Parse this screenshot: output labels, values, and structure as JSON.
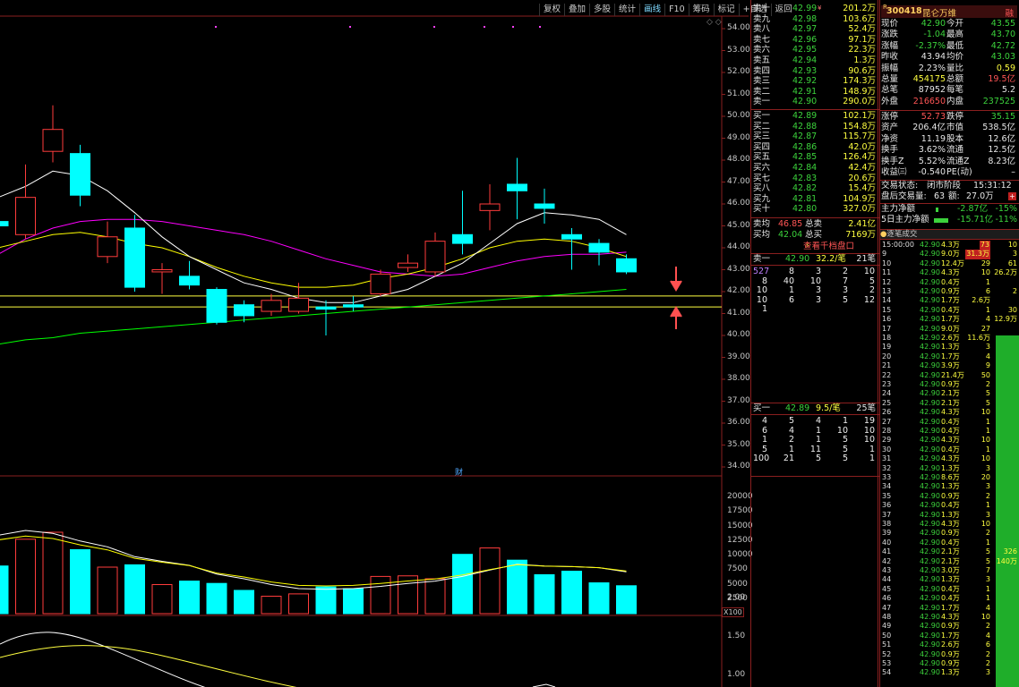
{
  "toolbar": [
    "复权",
    "叠加",
    "多股",
    "统计",
    "画线",
    "F10",
    "筹码",
    "标记",
    "+自选",
    "返回"
  ],
  "axis_main": [
    "54.00",
    "53.00",
    "52.00",
    "51.00",
    "50.00",
    "49.00",
    "48.00",
    "47.00",
    "46.00",
    "45.00",
    "44.00",
    "43.00",
    "42.00",
    "41.00",
    "40.00",
    "39.00",
    "38.00",
    "37.00",
    "36.00",
    "35.00",
    "34.00"
  ],
  "axis_vol": [
    "20000",
    "17500",
    "15000",
    "12500",
    "10000",
    "7500",
    "5000",
    "2500"
  ],
  "axis_vol_unit": "X100",
  "axis_ind": [
    "2.00",
    "1.50",
    "1.00"
  ],
  "cai_label": "财",
  "colors": {
    "up": "#ff3c3c",
    "down": "#00ffff",
    "ma5": "#ffffff",
    "ma10": "#ffff00",
    "ma20": "#ff00ff",
    "ma60": "#00ff00"
  },
  "chart_data": {
    "type": "candlestick",
    "ylim": [
      34,
      54.5
    ],
    "candles": [
      {
        "o": 45.2,
        "c": 45.0,
        "h": 45.6,
        "l": 44.6
      },
      {
        "o": 44.6,
        "c": 46.3,
        "h": 47.8,
        "l": 44.4
      },
      {
        "o": 48.4,
        "c": 49.4,
        "h": 50.5,
        "l": 47.9
      },
      {
        "o": 48.3,
        "c": 46.4,
        "h": 48.7,
        "l": 45.9
      },
      {
        "o": 43.6,
        "c": 44.5,
        "h": 45.2,
        "l": 43.3
      },
      {
        "o": 44.9,
        "c": 42.2,
        "h": 45.5,
        "l": 42.0
      },
      {
        "o": 42.9,
        "c": 43.0,
        "h": 43.3,
        "l": 41.9
      },
      {
        "o": 42.7,
        "c": 42.3,
        "h": 43.4,
        "l": 42.1
      },
      {
        "o": 42.1,
        "c": 40.6,
        "h": 42.2,
        "l": 40.5
      },
      {
        "o": 41.4,
        "c": 40.9,
        "h": 41.6,
        "l": 40.6
      },
      {
        "o": 41.1,
        "c": 41.6,
        "h": 41.9,
        "l": 40.9
      },
      {
        "o": 41.1,
        "c": 41.7,
        "h": 42.4,
        "l": 41.0
      },
      {
        "o": 41.3,
        "c": 41.2,
        "h": 41.6,
        "l": 40.0
      },
      {
        "o": 41.4,
        "c": 41.3,
        "h": 41.8,
        "l": 41.1
      },
      {
        "o": 41.9,
        "c": 42.8,
        "h": 43.0,
        "l": 41.8
      },
      {
        "o": 43.1,
        "c": 43.3,
        "h": 43.7,
        "l": 42.9
      },
      {
        "o": 42.9,
        "c": 44.3,
        "h": 44.7,
        "l": 42.7
      },
      {
        "o": 44.6,
        "c": 44.2,
        "h": 46.6,
        "l": 43.7
      },
      {
        "o": 45.7,
        "c": 46.0,
        "h": 46.9,
        "l": 44.8
      },
      {
        "o": 46.9,
        "c": 46.6,
        "h": 48.1,
        "l": 45.3
      },
      {
        "o": 46.0,
        "c": 45.8,
        "h": 46.7,
        "l": 45.1
      },
      {
        "o": 44.6,
        "c": 44.4,
        "h": 44.9,
        "l": 43.0
      },
      {
        "o": 44.2,
        "c": 43.8,
        "h": 44.4,
        "l": 43.2
      },
      {
        "o": 43.5,
        "c": 42.9,
        "h": 43.7,
        "l": 42.8
      }
    ],
    "ma5": [
      46.3,
      46.8,
      47.5,
      47.3,
      46.6,
      45.6,
      44.5,
      43.6,
      43.0,
      42.4,
      42.1,
      41.7,
      41.5,
      41.5,
      41.8,
      42.1,
      42.7,
      43.3,
      44.2,
      45.1,
      45.6,
      45.5,
      45.3,
      44.6
    ],
    "ma10": [
      44.0,
      44.3,
      44.6,
      44.7,
      44.5,
      44.2,
      44.0,
      43.6,
      43.1,
      42.7,
      42.4,
      42.2,
      42.2,
      42.3,
      42.6,
      42.8,
      43.1,
      43.5,
      44.0,
      44.3,
      44.4,
      44.3,
      44.0,
      43.6
    ],
    "ma20": [
      43.7,
      44.4,
      44.9,
      45.2,
      45.3,
      45.3,
      45.2,
      45.0,
      44.8,
      44.6,
      44.3,
      43.9,
      43.5,
      43.2,
      42.9,
      42.8,
      42.7,
      42.8,
      43.1,
      43.4,
      43.6,
      43.7,
      43.7,
      43.8
    ],
    "ma60": [
      39.6,
      39.8,
      39.9,
      40.1,
      40.2,
      40.3,
      40.4,
      40.5,
      40.6,
      40.7,
      40.8,
      40.9,
      41.0,
      41.1,
      41.2,
      41.3,
      41.4,
      41.5,
      41.6,
      41.7,
      41.8,
      41.9,
      42.0,
      42.1
    ],
    "ref_lines": [
      41.8,
      41.3
    ],
    "volume": [
      8200,
      12800,
      14000,
      11000,
      8000,
      8400,
      5000,
      5600,
      5200,
      4000,
      3000,
      3400,
      4600,
      4300,
      6400,
      6500,
      6000,
      10200,
      11300,
      9200,
      6700,
      7300,
      5300,
      4800
    ],
    "vol_ma": [
      13500,
      14300,
      13800,
      12500,
      11500,
      9800,
      9000,
      8300,
      6800,
      6000,
      5000,
      4300,
      4200,
      4300,
      4700,
      5200,
      5600,
      6400,
      7500,
      8500,
      8200,
      8100,
      7900,
      7200
    ]
  },
  "quote": {
    "code": "300418",
    "name": "昆仑万维",
    "r_badge": "R",
    "tag": "融"
  },
  "sell_book": [
    {
      "label": "卖十",
      "price": "42.99",
      "vol": "201.2万",
      "hot": true,
      "mark": "¥"
    },
    {
      "label": "卖九",
      "price": "42.98",
      "vol": "103.6万"
    },
    {
      "label": "卖八",
      "price": "42.97",
      "vol": "52.4万"
    },
    {
      "label": "卖七",
      "price": "42.96",
      "vol": "97.1万"
    },
    {
      "label": "卖六",
      "price": "42.95",
      "vol": "22.3万"
    },
    {
      "label": "卖五",
      "price": "42.94",
      "vol": "1.3万"
    },
    {
      "label": "卖四",
      "price": "42.93",
      "vol": "90.6万"
    },
    {
      "label": "卖三",
      "price": "42.92",
      "vol": "174.3万"
    },
    {
      "label": "卖二",
      "price": "42.91",
      "vol": "148.9万"
    },
    {
      "label": "卖一",
      "price": "42.90",
      "vol": "290.0万"
    }
  ],
  "buy_book": [
    {
      "label": "买一",
      "price": "42.89",
      "vol": "102.1万"
    },
    {
      "label": "买二",
      "price": "42.88",
      "vol": "154.8万"
    },
    {
      "label": "买三",
      "price": "42.87",
      "vol": "115.7万"
    },
    {
      "label": "买四",
      "price": "42.86",
      "vol": "42.0万"
    },
    {
      "label": "买五",
      "price": "42.85",
      "vol": "126.4万"
    },
    {
      "label": "买六",
      "price": "42.84",
      "vol": "42.4万"
    },
    {
      "label": "买七",
      "price": "42.83",
      "vol": "20.6万"
    },
    {
      "label": "买八",
      "price": "42.82",
      "vol": "15.4万"
    },
    {
      "label": "买九",
      "price": "42.81",
      "vol": "104.9万"
    },
    {
      "label": "买十",
      "price": "42.80",
      "vol": "327.0万",
      "hot": true
    }
  ],
  "averages": [
    {
      "label": "卖均",
      "price": "46.85",
      "tlabel": "总卖",
      "tval": "2.41亿"
    },
    {
      "label": "买均",
      "price": "42.04",
      "tlabel": "总买",
      "tval": "7169万"
    }
  ],
  "qianque_btn": "查看千档盘口",
  "queue_sell": {
    "label": "卖一",
    "price": "42.90",
    "avg": "32.2/笔",
    "count": "21笔",
    "rows": [
      [
        "527",
        "8",
        "3",
        "2",
        "10"
      ],
      [
        "8",
        "40",
        "10",
        "7",
        "5"
      ],
      [
        "10",
        "1",
        "3",
        "3",
        "2"
      ],
      [
        "10",
        "6",
        "3",
        "5",
        "12"
      ],
      [
        "1",
        "",
        "",
        "",
        ""
      ]
    ]
  },
  "queue_buy": {
    "label": "买一",
    "price": "42.89",
    "avg": "9.5/笔",
    "count": "25笔",
    "rows": [
      [
        "4",
        "5",
        "4",
        "1",
        "19"
      ],
      [
        "6",
        "4",
        "1",
        "10",
        "10"
      ],
      [
        "1",
        "2",
        "1",
        "5",
        "10"
      ],
      [
        "5",
        "1",
        "11",
        "5",
        "1"
      ],
      [
        "100",
        "21",
        "5",
        "5",
        "1"
      ]
    ]
  },
  "stats": [
    {
      "l1": "现价",
      "v1": "42.90",
      "c1": "green",
      "l2": "今开",
      "v2": "43.55",
      "c2": "green"
    },
    {
      "l1": "涨跌",
      "v1": "-1.04",
      "c1": "green",
      "l2": "最高",
      "v2": "43.70",
      "c2": "green"
    },
    {
      "l1": "涨幅",
      "v1": "-2.37%",
      "c1": "green",
      "l2": "最低",
      "v2": "42.72",
      "c2": "green"
    },
    {
      "l1": "昨收",
      "v1": "43.94",
      "c1": "white",
      "l2": "均价",
      "v2": "43.03",
      "c2": "green"
    },
    {
      "l1": "振幅",
      "v1": "2.23%",
      "c1": "white",
      "l2": "量比",
      "v2": "0.59",
      "c2": "yellow"
    },
    {
      "l1": "总量",
      "v1": "454175",
      "c1": "yellow",
      "l2": "总额",
      "v2": "19.5亿",
      "c2": "red"
    },
    {
      "l1": "总笔",
      "v1": "87952",
      "c1": "white",
      "l2": "每笔",
      "v2": "5.2",
      "c2": "white"
    },
    {
      "l1": "外盘",
      "v1": "216650",
      "c1": "red",
      "l2": "内盘",
      "v2": "237525",
      "c2": "green"
    },
    {
      "l1": "涨停",
      "v1": "52.73",
      "c1": "red",
      "l2": "跌停",
      "v2": "35.15",
      "c2": "green"
    },
    {
      "l1": "资产",
      "v1": "206.4亿",
      "c1": "white",
      "l2": "市值",
      "v2": "538.5亿",
      "c2": "white"
    },
    {
      "l1": "净资",
      "v1": "11.19",
      "c1": "white",
      "l2": "股本",
      "v2": "12.6亿",
      "c2": "white"
    },
    {
      "l1": "换手",
      "v1": "3.62%",
      "c1": "white",
      "l2": "流通",
      "v2": "12.5亿",
      "c2": "white"
    },
    {
      "l1": "换手Z",
      "v1": "5.52%",
      "c1": "white",
      "l2": "流通Z",
      "v2": "8.23亿",
      "c2": "white"
    },
    {
      "l1": "收益㈢",
      "v1": "-0.540",
      "c1": "white",
      "l2": "PE(动)",
      "v2": "–",
      "c2": "white"
    }
  ],
  "trade_status": {
    "label": "交易状态:",
    "value": "闭市阶段",
    "time": "15:31:12"
  },
  "after_hours": {
    "label": "盘后交易量:",
    "vol": "63",
    "amt_label": "额:",
    "amt": "27.0万"
  },
  "flow": [
    {
      "label": "主力净额",
      "value": "-2.87亿",
      "pct": "-15%"
    },
    {
      "label": "5日主力净额",
      "value": "-15.71亿",
      "pct": "-11%"
    }
  ],
  "tick_header": {
    "title": "逐笔成交"
  },
  "ticks": [
    {
      "t": "15:00:00",
      "p": "42.90",
      "v": "4.3万",
      "n": "73",
      "x": "10",
      "hl": "red"
    },
    {
      "t": "9",
      "p": "42.90",
      "v": "9.0万",
      "n": "31.3万",
      "x": "3",
      "hl": "red"
    },
    {
      "t": "10",
      "p": "42.90",
      "v": "12.4万",
      "n": "29",
      "x": "61"
    },
    {
      "t": "11",
      "p": "42.90",
      "v": "4.3万",
      "n": "10",
      "x": "26.2万"
    },
    {
      "t": "12",
      "p": "42.90",
      "v": "0.4万",
      "n": "1",
      "x": ""
    },
    {
      "t": "13",
      "p": "42.90",
      "v": "0.9万",
      "n": "6",
      "x": "2"
    },
    {
      "t": "14",
      "p": "42.90",
      "v": "1.7万",
      "n": "2.6万",
      "x": ""
    },
    {
      "t": "15",
      "p": "42.90",
      "v": "0.4万",
      "n": "1",
      "x": "30"
    },
    {
      "t": "16",
      "p": "42.90",
      "v": "1.7万",
      "n": "4",
      "x": "12.9万"
    },
    {
      "t": "17",
      "p": "42.90",
      "v": "9.0万",
      "n": "27",
      "x": ""
    },
    {
      "t": "18",
      "p": "42.90",
      "v": "2.6万",
      "n": "11.6万",
      "x": ""
    },
    {
      "t": "19",
      "p": "42.90",
      "v": "1.3万",
      "n": "3",
      "x": ""
    },
    {
      "t": "20",
      "p": "42.90",
      "v": "1.7万",
      "n": "4",
      "x": ""
    },
    {
      "t": "21",
      "p": "42.90",
      "v": "3.9万",
      "n": "9",
      "x": ""
    },
    {
      "t": "22",
      "p": "42.90",
      "v": "21.4万",
      "n": "50",
      "x": ""
    },
    {
      "t": "23",
      "p": "42.90",
      "v": "0.9万",
      "n": "2",
      "x": ""
    },
    {
      "t": "24",
      "p": "42.90",
      "v": "2.1万",
      "n": "5",
      "x": ""
    },
    {
      "t": "25",
      "p": "42.90",
      "v": "2.1万",
      "n": "5",
      "x": ""
    },
    {
      "t": "26",
      "p": "42.90",
      "v": "4.3万",
      "n": "10",
      "x": ""
    },
    {
      "t": "27",
      "p": "42.90",
      "v": "0.4万",
      "n": "1",
      "x": ""
    },
    {
      "t": "28",
      "p": "42.90",
      "v": "0.4万",
      "n": "1",
      "x": ""
    },
    {
      "t": "29",
      "p": "42.90",
      "v": "4.3万",
      "n": "10",
      "x": ""
    },
    {
      "t": "30",
      "p": "42.90",
      "v": "0.4万",
      "n": "1",
      "x": ""
    },
    {
      "t": "31",
      "p": "42.90",
      "v": "4.3万",
      "n": "10",
      "x": ""
    },
    {
      "t": "32",
      "p": "42.90",
      "v": "1.3万",
      "n": "3",
      "x": ""
    },
    {
      "t": "33",
      "p": "42.90",
      "v": "8.6万",
      "n": "20",
      "x": ""
    },
    {
      "t": "34",
      "p": "42.90",
      "v": "1.3万",
      "n": "3",
      "x": ""
    },
    {
      "t": "35",
      "p": "42.90",
      "v": "0.9万",
      "n": "2",
      "x": ""
    },
    {
      "t": "36",
      "p": "42.90",
      "v": "0.4万",
      "n": "1",
      "x": ""
    },
    {
      "t": "37",
      "p": "42.90",
      "v": "1.3万",
      "n": "3",
      "x": ""
    },
    {
      "t": "38",
      "p": "42.90",
      "v": "4.3万",
      "n": "10",
      "x": ""
    },
    {
      "t": "39",
      "p": "42.90",
      "v": "0.9万",
      "n": "2",
      "x": ""
    },
    {
      "t": "40",
      "p": "42.90",
      "v": "0.4万",
      "n": "1",
      "x": ""
    },
    {
      "t": "41",
      "p": "42.90",
      "v": "2.1万",
      "n": "5",
      "x": "326"
    },
    {
      "t": "42",
      "p": "42.90",
      "v": "2.1万",
      "n": "5",
      "x": "140万"
    },
    {
      "t": "43",
      "p": "42.90",
      "v": "3.0万",
      "n": "7",
      "x": ""
    },
    {
      "t": "44",
      "p": "42.90",
      "v": "1.3万",
      "n": "3",
      "x": ""
    },
    {
      "t": "45",
      "p": "42.90",
      "v": "0.4万",
      "n": "1",
      "x": ""
    },
    {
      "t": "46",
      "p": "42.90",
      "v": "0.4万",
      "n": "1",
      "x": ""
    },
    {
      "t": "47",
      "p": "42.90",
      "v": "1.7万",
      "n": "4",
      "x": ""
    },
    {
      "t": "48",
      "p": "42.90",
      "v": "4.3万",
      "n": "10",
      "x": ""
    },
    {
      "t": "49",
      "p": "42.90",
      "v": "0.9万",
      "n": "2",
      "x": ""
    },
    {
      "t": "50",
      "p": "42.90",
      "v": "1.7万",
      "n": "4",
      "x": ""
    },
    {
      "t": "51",
      "p": "42.90",
      "v": "2.6万",
      "n": "6",
      "x": ""
    },
    {
      "t": "52",
      "p": "42.90",
      "v": "0.9万",
      "n": "2",
      "x": ""
    },
    {
      "t": "53",
      "p": "42.90",
      "v": "0.9万",
      "n": "2",
      "x": ""
    },
    {
      "t": "54",
      "p": "42.90",
      "v": "1.3万",
      "n": "3",
      "x": ""
    }
  ]
}
